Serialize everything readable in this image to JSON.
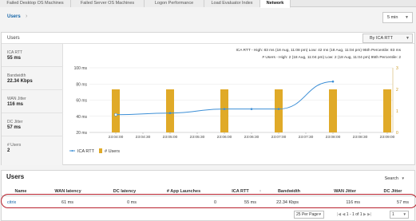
{
  "tabs": [
    "Failed Desktop OS Machines",
    "Failed Server OS Machines",
    "Logon Performance",
    "Load Evaluator Index",
    "Network"
  ],
  "active_tab": "Network",
  "breadcrumb": {
    "label": "Users",
    "separator": "›"
  },
  "time_range": {
    "selected": "5 min"
  },
  "users_panel": {
    "title": "Users",
    "metric_select": "By ICA RTT",
    "stats": [
      {
        "label": "ICA RTT",
        "value": "55 ms"
      },
      {
        "label": "Bandwidth",
        "value": "22.34 Kbps"
      },
      {
        "label": "WAN Jitter",
        "value": "116 ms"
      },
      {
        "label": "DC Jitter",
        "value": "57 ms"
      },
      {
        "label": "# Users",
        "value": "2"
      }
    ]
  },
  "chart_data": {
    "type": "line",
    "summary_lines": [
      "ICA RTT - High: 83 ms (18 Aug, 11:08 pm) Low: 42 ms (18 Aug, 11:04 pm) 95th Percentile: 83 ms",
      "# Users - High: 2 (18 Aug, 11:04 pm) Low: 2 (18 Aug, 11:04 pm) 95th Percentile: 2"
    ],
    "categories": [
      "23:04:00",
      "23:04:30",
      "23:05:00",
      "23:05:30",
      "23:06:00",
      "23:06:30",
      "23:07:00",
      "23:07:30",
      "23:08:00",
      "23:08:30",
      "23:09:00"
    ],
    "y_left": {
      "ticks": [
        "100 ms",
        "80 ms",
        "60 ms",
        "40 ms",
        "20 ms"
      ],
      "range": [
        20,
        100
      ]
    },
    "y_right": {
      "ticks": [
        "3",
        "2",
        "1",
        "0"
      ],
      "range": [
        0,
        3
      ]
    },
    "series": [
      {
        "name": "ICA RTT",
        "kind": "line",
        "color": "#3d8fd6",
        "x": [
          "23:04:00",
          "23:05:00",
          "23:06:00",
          "23:06:30",
          "23:07:00",
          "23:08:00"
        ],
        "values": [
          42,
          44,
          49,
          49,
          49,
          83
        ]
      },
      {
        "name": "# Users",
        "kind": "bar",
        "color": "#e0aa28",
        "x": [
          "23:04:00",
          "23:05:00",
          "23:06:00",
          "23:07:00",
          "23:08:00",
          "23:09:00"
        ],
        "values": [
          2,
          2,
          2,
          2,
          2,
          2
        ]
      }
    ],
    "grid": true,
    "legend": "bottom-left"
  },
  "users_table": {
    "title": "Users",
    "search_label": "Search",
    "columns": [
      "Name",
      "WAN latency",
      "DC latency",
      "# App Launches",
      "ICA RTT",
      "Bandwidth",
      "WAN Jitter",
      "DC Jitter"
    ],
    "rows": [
      {
        "name": "citrix",
        "wan_latency": "61 ms",
        "dc_latency": "0 ms",
        "app_launches": "0",
        "ica_rtt": "55 ms",
        "bandwidth": "22.34 Kbps",
        "wan_jitter": "116 ms",
        "dc_jitter": "57 ms"
      }
    ],
    "per_page": "25 Per Page",
    "page_info": "1 - 1 of 1",
    "page": "1"
  }
}
